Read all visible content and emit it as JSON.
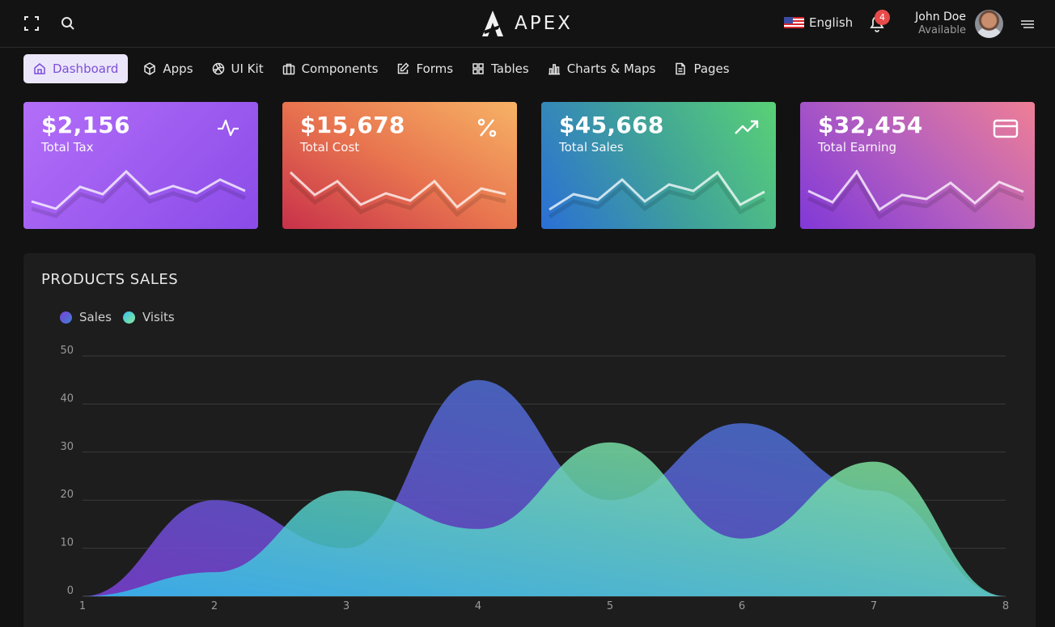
{
  "brand": {
    "name": "APEX"
  },
  "header": {
    "language": "English",
    "notification_count": "4",
    "user": {
      "name": "John Doe",
      "status": "Available"
    }
  },
  "nav": {
    "items": [
      {
        "label": "Dashboard",
        "icon": "home-icon",
        "active": true
      },
      {
        "label": "Apps",
        "icon": "box-icon"
      },
      {
        "label": "UI Kit",
        "icon": "aperture-icon"
      },
      {
        "label": "Components",
        "icon": "briefcase-icon"
      },
      {
        "label": "Forms",
        "icon": "edit-icon"
      },
      {
        "label": "Tables",
        "icon": "grid-icon"
      },
      {
        "label": "Charts & Maps",
        "icon": "bar-chart-icon"
      },
      {
        "label": "Pages",
        "icon": "file-text-icon"
      }
    ]
  },
  "cards": [
    {
      "value": "$2,156",
      "label": "Total Tax",
      "icon": "activity-icon"
    },
    {
      "value": "$15,678",
      "label": "Total Cost",
      "icon": "percent-icon"
    },
    {
      "value": "$45,668",
      "label": "Total Sales",
      "icon": "trending-up-icon"
    },
    {
      "value": "$32,454",
      "label": "Total Earning",
      "icon": "credit-card-icon"
    }
  ],
  "products_sales": {
    "title": "PRODUCTS SALES"
  },
  "chart_data": {
    "type": "area",
    "title": "PRODUCTS SALES",
    "x": [
      1,
      2,
      3,
      4,
      5,
      6,
      7,
      8
    ],
    "ylim": [
      0,
      50
    ],
    "yticks": [
      0,
      10,
      20,
      30,
      40,
      50
    ],
    "grid": true,
    "legend": "top-left",
    "series": [
      {
        "name": "Sales",
        "values": [
          0,
          20,
          10,
          45,
          20,
          36,
          22,
          0
        ],
        "color_from": "#7b3fd4",
        "color_to": "#3e82d8"
      },
      {
        "name": "Visits",
        "values": [
          0,
          5,
          22,
          14,
          32,
          12,
          28,
          0
        ],
        "color_from": "#35c2ee",
        "color_to": "#8be89a"
      }
    ]
  }
}
